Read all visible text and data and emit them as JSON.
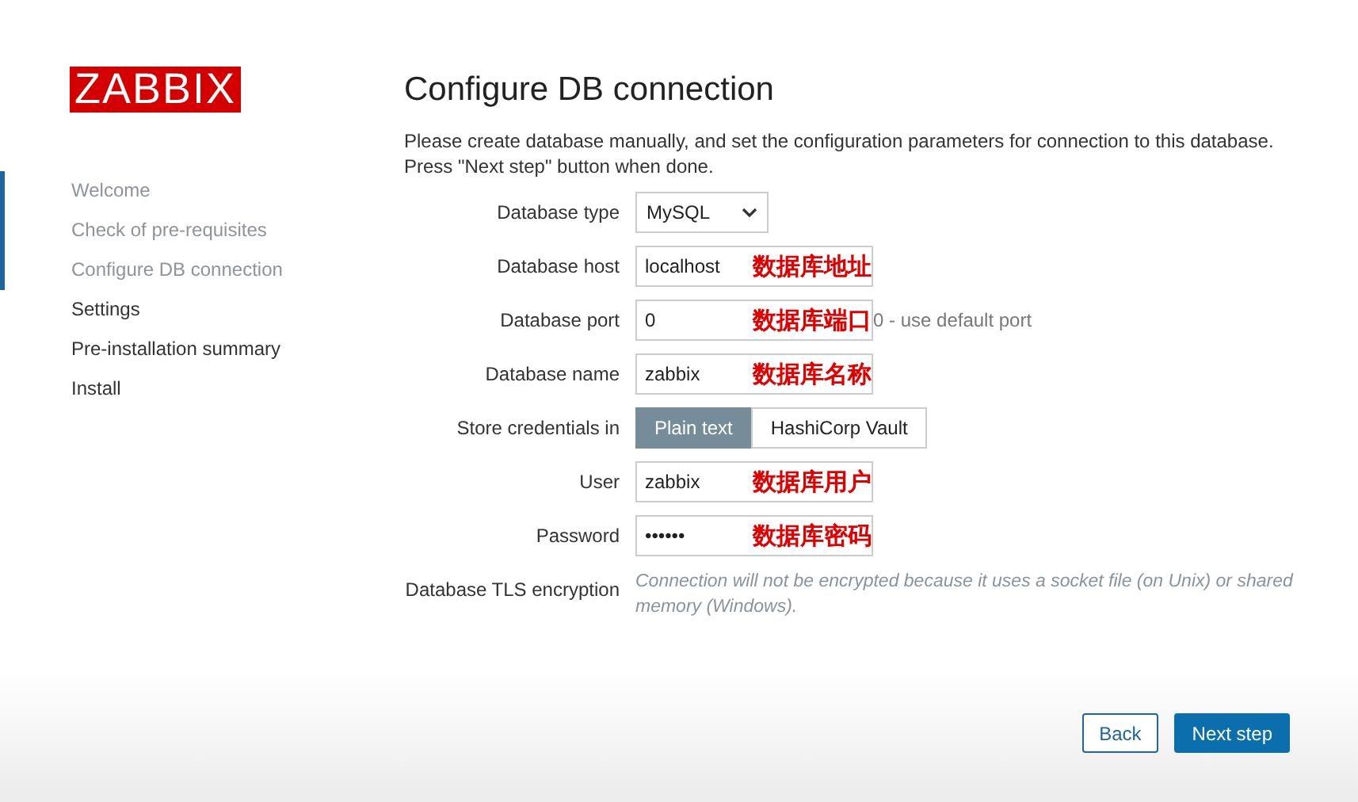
{
  "logo": "ZABBIX",
  "steps": [
    {
      "label": "Welcome",
      "done": true
    },
    {
      "label": "Check of pre-requisites",
      "done": true
    },
    {
      "label": "Configure DB connection",
      "done": true
    },
    {
      "label": "Settings",
      "done": false
    },
    {
      "label": "Pre-installation summary",
      "done": false
    },
    {
      "label": "Install",
      "done": false
    }
  ],
  "title": "Configure DB connection",
  "intro": [
    "Please create database manually, and set the configuration parameters for connection to this database.",
    "Press \"Next step\" button when done."
  ],
  "fields": [
    {
      "kind": "select",
      "label": "Database type",
      "value": "MySQL"
    },
    {
      "kind": "input",
      "label": "Database host",
      "value": "localhost",
      "annotation": "数据库地址"
    },
    {
      "kind": "input",
      "label": "Database port",
      "value": "0",
      "annotation": "数据库端口",
      "hint": "0 - use default port"
    },
    {
      "kind": "input",
      "label": "Database name",
      "value": "zabbix",
      "annotation": "数据库名称"
    },
    {
      "kind": "segmented",
      "label": "Store credentials in",
      "options": [
        {
          "label": "Plain text",
          "selected": true
        },
        {
          "label": "HashiCorp Vault",
          "selected": false
        }
      ]
    },
    {
      "kind": "input",
      "label": "User",
      "value": "zabbix",
      "annotation": "数据库用户"
    },
    {
      "kind": "input",
      "label": "Password",
      "value": "••••••",
      "annotation": "数据库密码"
    },
    {
      "kind": "note",
      "label": "Database TLS encryption",
      "text": "Connection will not be encrypted because it uses a socket file (on Unix) or shared memory (Windows)."
    }
  ],
  "buttons": [
    {
      "label": "Back",
      "kind": "secondary"
    },
    {
      "label": "Next step",
      "kind": "primary"
    }
  ]
}
